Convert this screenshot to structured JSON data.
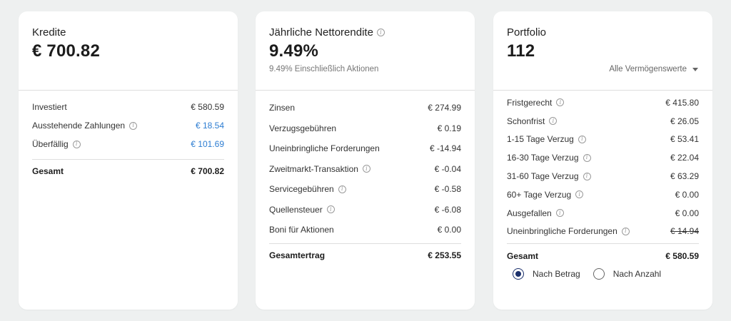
{
  "colors": {
    "link": "#2d7dd2",
    "radio_selected": "#1a2f6b",
    "background": "#eef0f0"
  },
  "kredite": {
    "title": "Kredite",
    "value": "€ 700.82",
    "rows": [
      {
        "label": "Investiert",
        "value": "€ 580.59",
        "info": false
      },
      {
        "label": "Ausstehende Zahlungen",
        "value": "€ 18.54",
        "info": true
      },
      {
        "label": "Überfällig",
        "value": "€ 101.69",
        "info": true
      }
    ],
    "total": {
      "label": "Gesamt",
      "value": "€ 700.82"
    }
  },
  "rendite": {
    "title": "Jährliche Nettorendite",
    "value": "9.49%",
    "subtitle": "9.49% Einschließlich Aktionen",
    "rows": [
      {
        "label": "Zinsen",
        "value": "€ 274.99"
      },
      {
        "label": "Verzugsgebühren",
        "value": "€ 0.19"
      },
      {
        "label": "Uneinbringliche Forderungen",
        "value": "€ -14.94"
      },
      {
        "label": "Zweitmarkt-Transaktion",
        "value": "€ -0.04"
      },
      {
        "label": "Servicegebühren",
        "value": "€ -0.58"
      },
      {
        "label": "Quellensteuer",
        "value": "€ -6.08"
      },
      {
        "label": "Boni für Aktionen",
        "value": "€ 0.00"
      }
    ],
    "total": {
      "label": "Gesamtertrag",
      "value": "€ 253.55"
    }
  },
  "portfolio": {
    "title": "Portfolio",
    "value": "112",
    "filter_label": "Alle Vermögenswerte",
    "rows": [
      {
        "label": "Fristgerecht",
        "value": "€ 415.80"
      },
      {
        "label": "Schonfrist",
        "value": "€ 26.05"
      },
      {
        "label": "1-15 Tage Verzug",
        "value": "€ 53.41"
      },
      {
        "label": "16-30 Tage Verzug",
        "value": "€ 22.04"
      },
      {
        "label": "31-60 Tage Verzug",
        "value": "€ 63.29"
      },
      {
        "label": "60+ Tage Verzug",
        "value": "€ 0.00"
      },
      {
        "label": "Ausgefallen",
        "value": "€ 0.00"
      },
      {
        "label": "Uneinbringliche Forderungen",
        "value": "€ 14.94"
      }
    ],
    "total": {
      "label": "Gesamt",
      "value": "€ 580.59"
    },
    "radio": {
      "by_amount": "Nach Betrag",
      "by_count": "Nach Anzahl"
    }
  }
}
